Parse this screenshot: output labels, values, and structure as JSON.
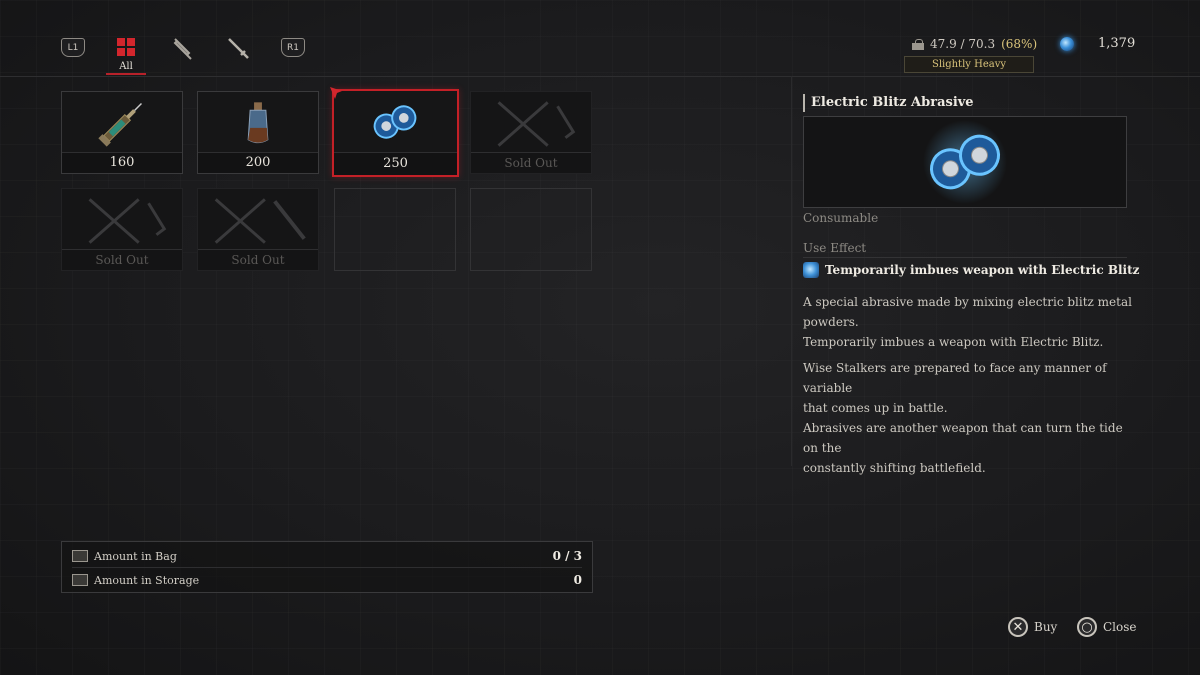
{
  "tabs": {
    "l1": "L1",
    "r1": "R1",
    "active_label": "All",
    "items": [
      "all-icon",
      "consumable-icon",
      "weapon-icon"
    ]
  },
  "status": {
    "weight": "47.9 / 70.3",
    "weight_pct": "(68%)",
    "load_state": "Slightly Heavy",
    "currency": "1,379"
  },
  "shop": {
    "slots": [
      {
        "kind": "item",
        "icon": "syringe-icon",
        "price": "160"
      },
      {
        "kind": "item",
        "icon": "lantern-bottle-icon",
        "price": "200"
      },
      {
        "kind": "item",
        "icon": "electric-abrasive-icon",
        "price": "250",
        "selected": true
      },
      {
        "kind": "sold",
        "icon": "crossed-weapons-icon",
        "price": "Sold Out"
      },
      {
        "kind": "sold",
        "icon": "crossed-weapons-icon",
        "price": "Sold Out"
      },
      {
        "kind": "sold",
        "icon": "crossed-weapons-icon",
        "price": "Sold Out"
      },
      {
        "kind": "empty"
      },
      {
        "kind": "empty"
      }
    ]
  },
  "detail": {
    "title": "Electric Blitz Abrasive",
    "category": "Consumable",
    "use_label": "Use Effect",
    "effect": "Temporarily imbues weapon with Electric Blitz",
    "desc1_line1": "A special abrasive made by mixing electric blitz metal",
    "desc1_line2": "powders.",
    "desc1_line3": "Temporarily imbues a weapon with Electric Blitz.",
    "desc2_line1": "Wise Stalkers are prepared to face any manner of variable",
    "desc2_line2": "that comes up in battle.",
    "desc2_line3": "Abrasives are another weapon that can turn the tide on the",
    "desc2_line4": "constantly shifting battlefield."
  },
  "amounts": {
    "bag_label": "Amount in Bag",
    "bag_value": "0 / 3",
    "storage_label": "Amount in Storage",
    "storage_value": "0"
  },
  "buttons": {
    "buy_symbol": "✕",
    "buy": "Buy",
    "close_symbol": "○",
    "close": "Close"
  },
  "colors": {
    "accent_red": "#c42027",
    "status_yellow": "#d9c37b",
    "electric_blue": "#3a8fd8"
  }
}
